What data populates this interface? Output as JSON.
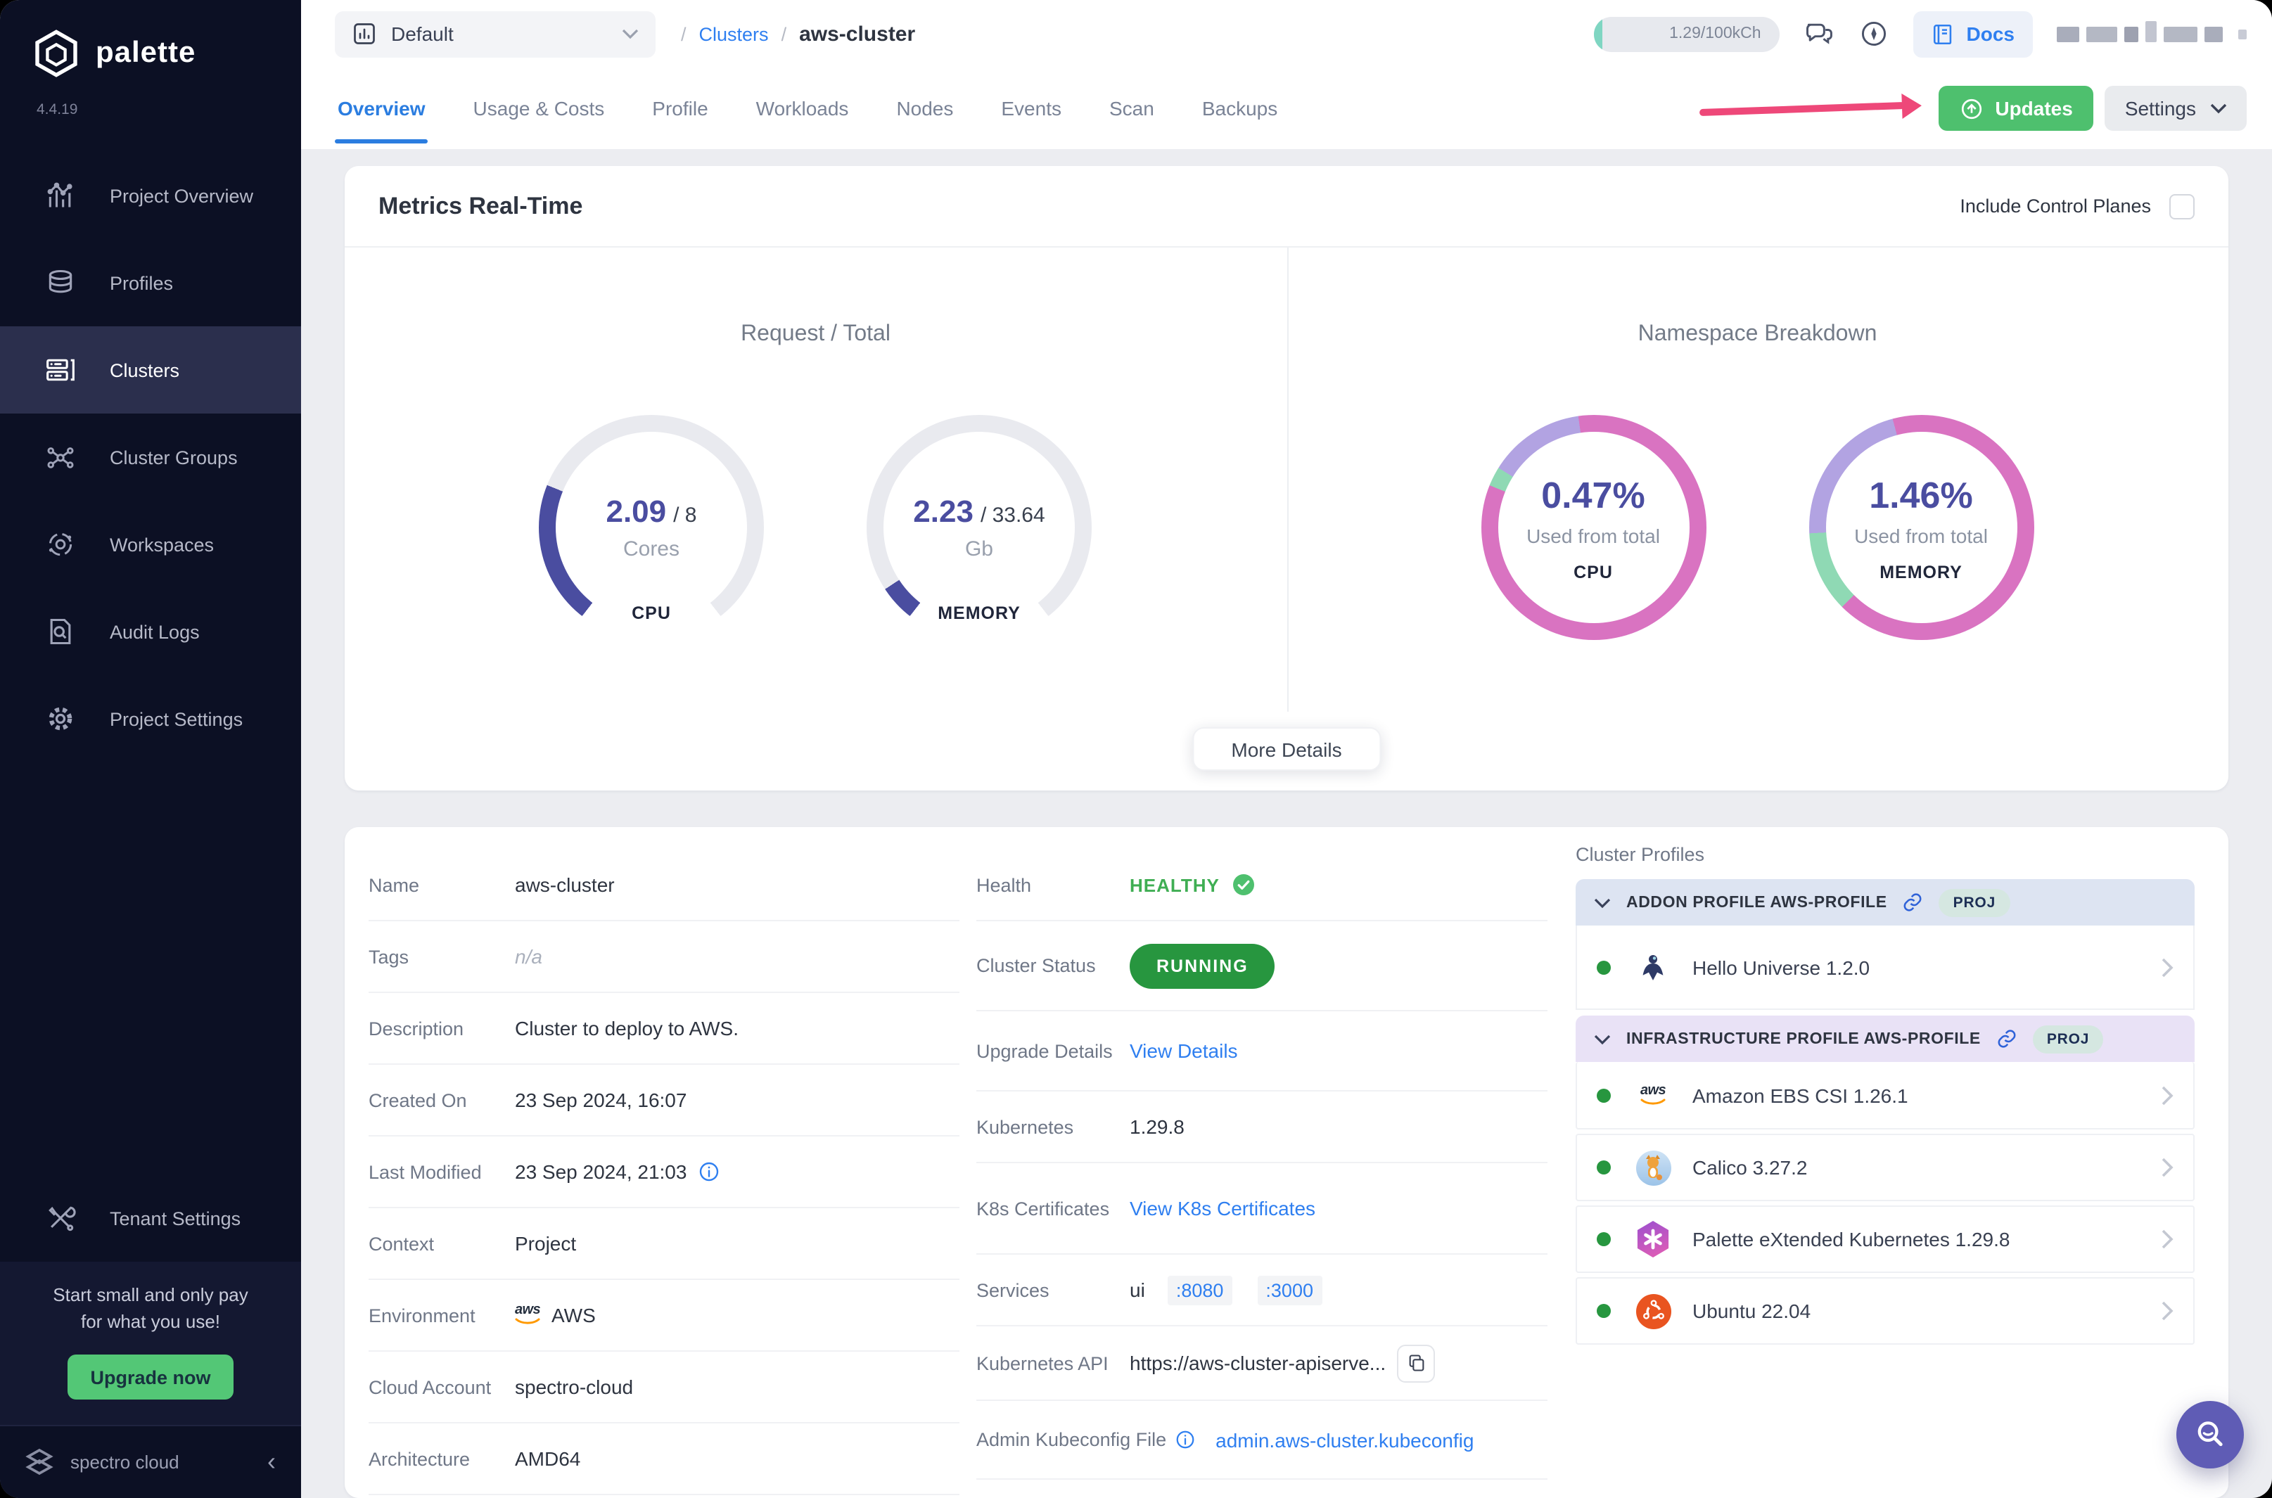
{
  "app": {
    "brand": "palette",
    "version": "4.4.19",
    "footer_brand": "spectro cloud"
  },
  "sidebar": {
    "items": [
      {
        "label": "Project Overview"
      },
      {
        "label": "Profiles"
      },
      {
        "label": "Clusters"
      },
      {
        "label": "Cluster Groups"
      },
      {
        "label": "Workspaces"
      },
      {
        "label": "Audit Logs"
      },
      {
        "label": "Project Settings"
      }
    ],
    "tenant_settings": {
      "label": "Tenant Settings"
    },
    "promo": {
      "line1": "Start small and only pay",
      "line2": "for what you use!",
      "cta": "Upgrade now"
    }
  },
  "topbar": {
    "project_selector": {
      "value": "Default"
    },
    "breadcrumb": {
      "separator": "/",
      "parent": "Clusters",
      "current": "aws-cluster"
    },
    "usage_badge": "1.29/100kCh",
    "docs_label": "Docs"
  },
  "tabs": {
    "items": [
      "Overview",
      "Usage & Costs",
      "Profile",
      "Workloads",
      "Nodes",
      "Events",
      "Scan",
      "Backups"
    ],
    "active": "Overview"
  },
  "actions": {
    "updates": "Updates",
    "settings": "Settings"
  },
  "metrics": {
    "title": "Metrics Real-Time",
    "include_control_planes": "Include Control Planes",
    "checkbox_checked": false,
    "request_total": {
      "title": "Request / Total",
      "cpu": {
        "value": "2.09",
        "total": "/ 8",
        "unit": "Cores",
        "label": "CPU",
        "percent": 26.1
      },
      "memory": {
        "value": "2.23",
        "total": "/ 33.64",
        "unit": "Gb",
        "label": "MEMORY",
        "percent": 6.6
      }
    },
    "namespace": {
      "title": "Namespace Breakdown",
      "cpu": {
        "percent": "0.47%",
        "caption": "Used from total",
        "label": "CPU",
        "segments": [
          [
            "pink",
            0,
            292
          ],
          [
            "mint",
            292,
            302
          ],
          [
            "lavender",
            302,
            352
          ],
          [
            "pink",
            352,
            360
          ]
        ]
      },
      "memory": {
        "percent": "1.46%",
        "caption": "Used from total",
        "label": "MEMORY",
        "segments": [
          [
            "pink",
            0,
            225
          ],
          [
            "mint",
            225,
            267
          ],
          [
            "lavender",
            267,
            345
          ],
          [
            "pink",
            345,
            360
          ]
        ]
      }
    },
    "more_details": "More Details"
  },
  "details": {
    "left": [
      {
        "label": "Name",
        "value": "aws-cluster"
      },
      {
        "label": "Tags",
        "value": "n/a"
      },
      {
        "label": "Description",
        "value": "Cluster to deploy to AWS."
      },
      {
        "label": "Created On",
        "value": "23 Sep 2024, 16:07"
      },
      {
        "label": "Last Modified",
        "value": "23 Sep 2024, 21:03"
      },
      {
        "label": "Context",
        "value": "Project"
      },
      {
        "label": "Environment",
        "value": "AWS"
      },
      {
        "label": "Cloud Account",
        "value": "spectro-cloud"
      },
      {
        "label": "Architecture",
        "value": "AMD64"
      }
    ],
    "middle": [
      {
        "label": "Health",
        "value": "HEALTHY"
      },
      {
        "label": "Cluster Status",
        "value": "RUNNING"
      },
      {
        "label": "Upgrade Details",
        "value": "View Details"
      },
      {
        "label": "Kubernetes",
        "value": "1.29.8"
      },
      {
        "label": "K8s Certificates",
        "value": "View K8s Certificates"
      },
      {
        "label": "Services",
        "value": "ui",
        "ports": [
          ":8080",
          ":3000"
        ]
      },
      {
        "label": "Kubernetes API",
        "value": "https://aws-cluster-apiserve..."
      },
      {
        "label": "Admin Kubeconfig File",
        "value": "admin.aws-cluster.kubeconfig"
      }
    ]
  },
  "profiles": {
    "heading": "Cluster Profiles",
    "groups": [
      {
        "title": "ADDON PROFILE AWS-PROFILE",
        "badge": "PROJ",
        "items": [
          {
            "name": "Hello Universe 1.2.0"
          }
        ]
      },
      {
        "title": "INFRASTRUCTURE PROFILE AWS-PROFILE",
        "badge": "PROJ",
        "items": [
          {
            "name": "Amazon EBS CSI 1.26.1"
          },
          {
            "name": "Calico 3.27.2"
          },
          {
            "name": "Palette eXtended Kubernetes 1.29.8"
          },
          {
            "name": "Ubuntu 22.04"
          }
        ]
      }
    ]
  },
  "colors": {
    "pink": "#d973c1",
    "lavender": "#b2a3e2",
    "mint": "#8fd9b4",
    "gauge": "#4a4da0",
    "track": "#e9eaef",
    "accent_blue": "#2f7ff0",
    "updates_green": "#4ec06e",
    "running_green": "#27963f",
    "healthy_green": "#3fae53",
    "annotation_pink": "#ee4879",
    "fab_purple": "#5f5cb5"
  }
}
